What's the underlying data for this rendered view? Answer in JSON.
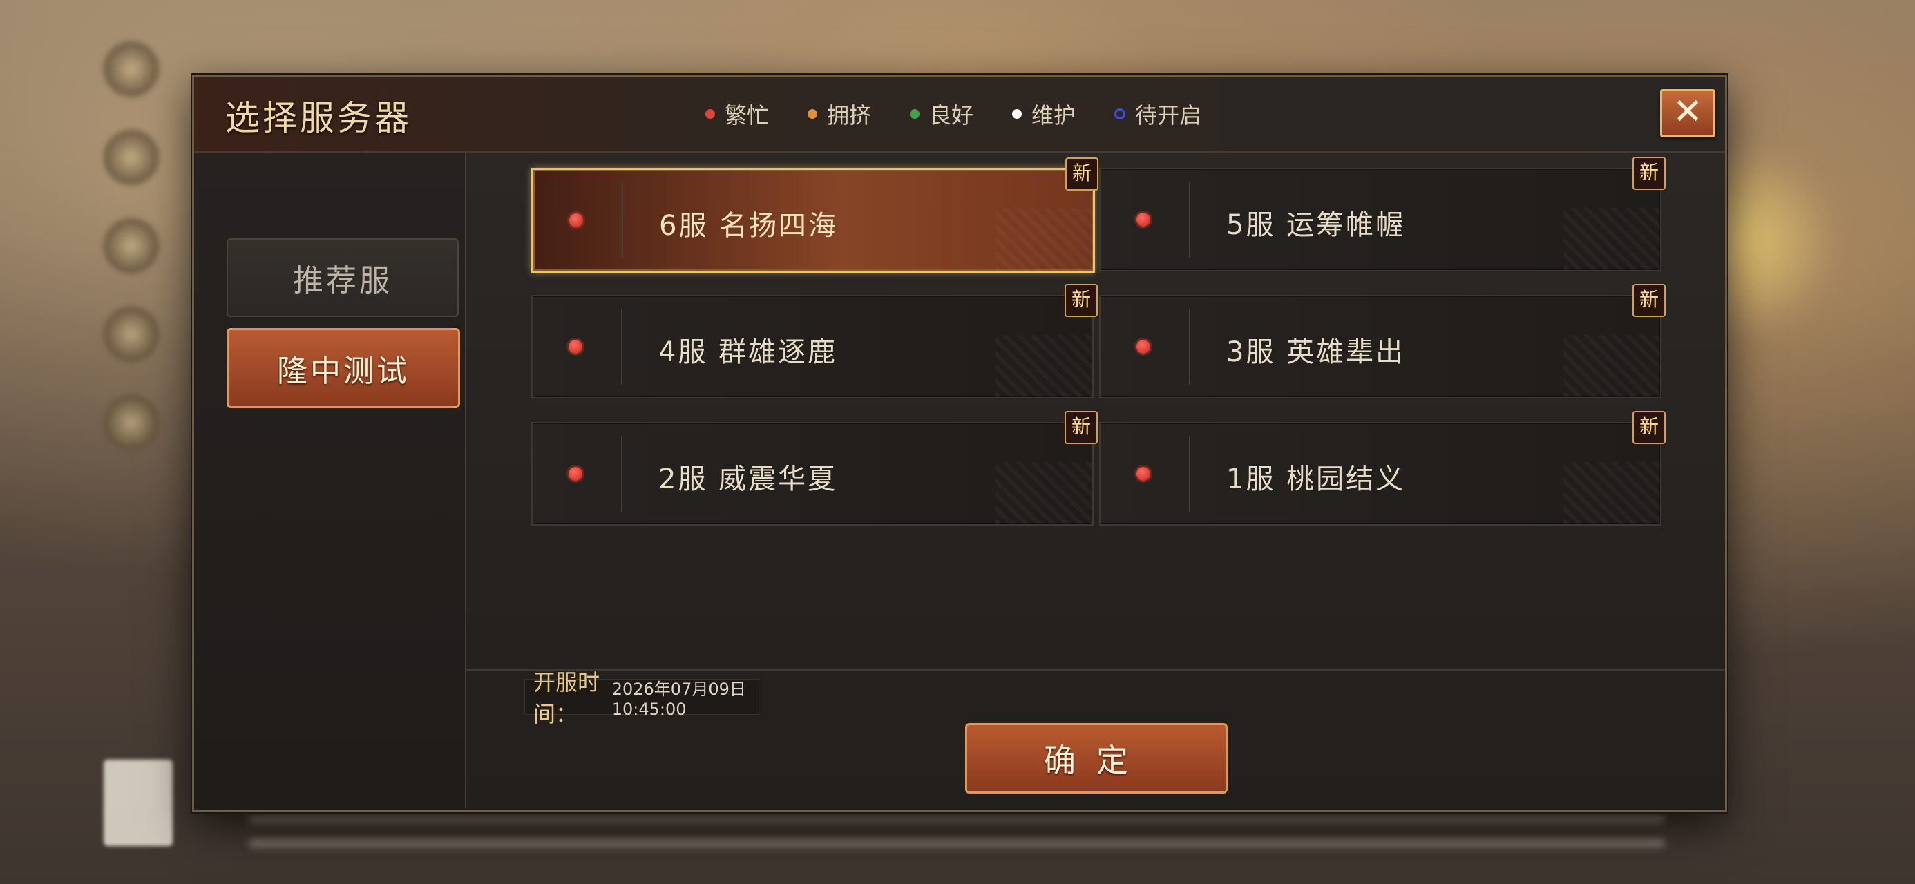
{
  "dialog": {
    "title": "选择服务器",
    "close_label": "✕"
  },
  "legend": [
    {
      "label": "繁忙",
      "color": "#e0443a"
    },
    {
      "label": "拥挤",
      "color": "#e0913a"
    },
    {
      "label": "良好",
      "color": "#3fa14a"
    },
    {
      "label": "维护",
      "color": "#ffffff"
    },
    {
      "label": "待开启",
      "color": "#3a4fe0"
    }
  ],
  "sidebar": {
    "tabs": [
      {
        "label": "推荐服",
        "active": false
      },
      {
        "label": "隆中测试",
        "active": true
      }
    ]
  },
  "servers": [
    {
      "name": "6服  名扬四海",
      "badge": "新",
      "selected": true
    },
    {
      "name": "5服  运筹帷幄",
      "badge": "新",
      "selected": false
    },
    {
      "name": "4服  群雄逐鹿",
      "badge": "新",
      "selected": false
    },
    {
      "name": "3服  英雄辈出",
      "badge": "新",
      "selected": false
    },
    {
      "name": "2服  威震华夏",
      "badge": "新",
      "selected": false
    },
    {
      "name": "1服  桃园结义",
      "badge": "新",
      "selected": false
    }
  ],
  "footer": {
    "open_time_label": "开服时间：",
    "open_time_value": "2026年07月09日  10:45:00",
    "confirm_label": "确定"
  }
}
